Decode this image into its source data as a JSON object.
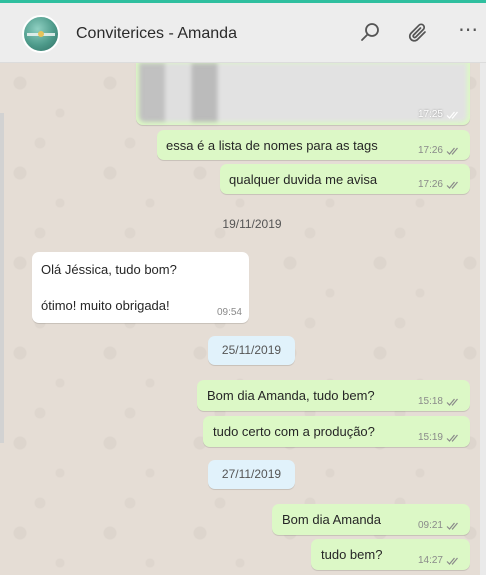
{
  "header": {
    "contact_name": "Conviterices - Amanda",
    "icons": [
      "search-icon",
      "attach-icon",
      "menu-icon"
    ],
    "menu_glyph": "⋯"
  },
  "colors": {
    "accent": "#2fbf9f",
    "outgoing_bubble": "#dcf8c6",
    "incoming_bubble": "#ffffff",
    "date_chip": "#e1f2fb",
    "chat_background": "#e5ddd5"
  },
  "messages": [
    {
      "type": "image",
      "direction": "out",
      "time": "17:25"
    },
    {
      "type": "text",
      "direction": "out",
      "text": "essa é a lista de nomes para as tags",
      "time": "17:26"
    },
    {
      "type": "text",
      "direction": "out",
      "text": "qualquer duvida me avisa",
      "time": "17:26"
    },
    {
      "type": "date",
      "text": "19/11/2019"
    },
    {
      "type": "text",
      "direction": "in",
      "lines": [
        "Olá Jéssica, tudo bom?",
        "ótimo! muito obrigada!"
      ],
      "time": "09:54"
    },
    {
      "type": "date",
      "text": "25/11/2019"
    },
    {
      "type": "text",
      "direction": "out",
      "text": "Bom dia Amanda, tudo bem?",
      "time": "15:18"
    },
    {
      "type": "text",
      "direction": "out",
      "text": "tudo certo com a produção?",
      "time": "15:19"
    },
    {
      "type": "date",
      "text": "27/11/2019"
    },
    {
      "type": "text",
      "direction": "out",
      "text": "Bom dia Amanda",
      "time": "09:21"
    },
    {
      "type": "text",
      "direction": "out",
      "text": "tudo bem?",
      "time": "14:27"
    }
  ]
}
